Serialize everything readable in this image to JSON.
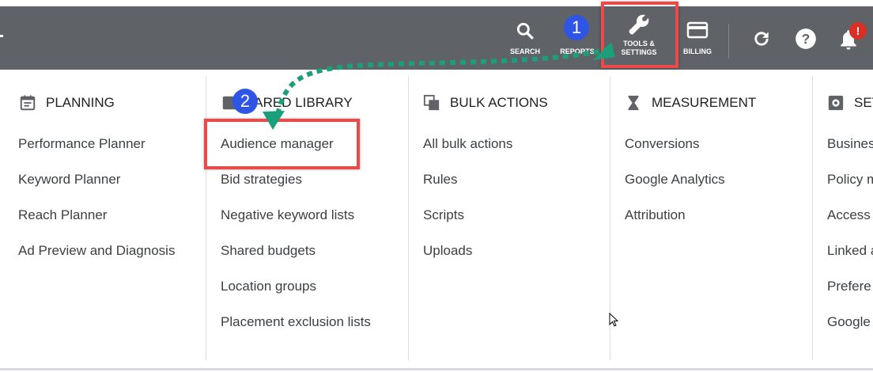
{
  "toolbar": {
    "search_label": "SEARCH",
    "reports_label": "REPORTS",
    "tools_label_line1": "TOOLS &",
    "tools_label_line2": "SETTINGS",
    "billing_label": "BILLING",
    "notification_badge": "!"
  },
  "annotations": {
    "step1": "1",
    "step2": "2",
    "highlight_color": "#ea4a4a",
    "badge_color": "#2f55e7",
    "arrow_color": "#1a9f7a"
  },
  "menu": {
    "planning": {
      "title": "PLANNING",
      "icon": "calendar-icon",
      "items": [
        "Performance Planner",
        "Keyword Planner",
        "Reach Planner",
        "Ad Preview and Diagnosis"
      ]
    },
    "shared_library": {
      "title": "HARED LIBRARY",
      "icon": "library-icon",
      "items": [
        "Audience manager",
        "Bid strategies",
        "Negative keyword lists",
        "Shared budgets",
        "Location groups",
        "Placement exclusion lists"
      ]
    },
    "bulk_actions": {
      "title": "BULK ACTIONS",
      "icon": "copy-icon",
      "items": [
        "All bulk actions",
        "Rules",
        "Scripts",
        "Uploads"
      ]
    },
    "measurement": {
      "title": "MEASUREMENT",
      "icon": "hourglass-icon",
      "items": [
        "Conversions",
        "Google Analytics",
        "Attribution"
      ]
    },
    "setup": {
      "title": "SET",
      "icon": "gear-icon",
      "items": [
        "Busines",
        "Policy m",
        "Access",
        "Linked a",
        "Prefere",
        "Google"
      ]
    }
  }
}
